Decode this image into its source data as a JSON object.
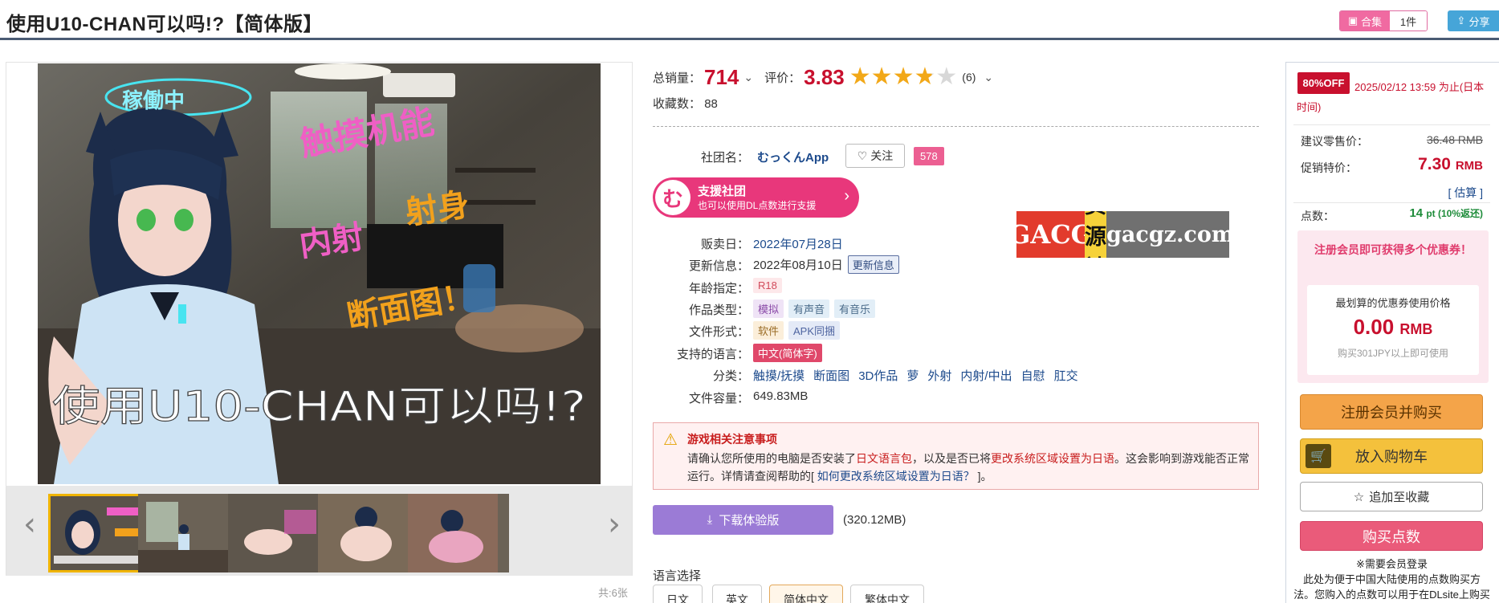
{
  "title": "使用U10-CHAN可以吗!?【简体版】",
  "collection": {
    "label": "合集",
    "count": "1件"
  },
  "share_label": "分享",
  "gallery": {
    "overlay_texts": [
      "稼働中",
      "触摸机能",
      "内射",
      "射身",
      "断面图！",
      "使用U10-CHAN可以吗!?"
    ],
    "count_label": "共:6张",
    "prev_icon": "‹",
    "next_icon": "›"
  },
  "stats": {
    "sales_label": "总销量：",
    "sales_value": "714",
    "rating_label": "评价：",
    "rating_value": "3.83",
    "rating_count": "(6)",
    "rating_stars": 3.83,
    "fav_label": "收藏数：",
    "fav_value": "88"
  },
  "circle": {
    "label": "社团名：",
    "name": "むっくんApp",
    "follow_label": "关注",
    "follow_count": "578"
  },
  "support_banner": {
    "icon": "む",
    "title": "支援社团",
    "subtitle": "也可以使用DL点数进行支援"
  },
  "ad_logo": {
    "part1": "GACG",
    "part2": "资源社",
    "part3": "gacgz.com"
  },
  "meta": {
    "release_label": "贩卖日：",
    "release_value": "2022年07月28日",
    "update_label": "更新信息：",
    "update_value": "2022年08月10日",
    "update_btn": "更新信息",
    "age_label": "年龄指定：",
    "age_value": "R18",
    "type_label": "作品类型：",
    "type_tags": [
      "模拟",
      "有声音",
      "有音乐"
    ],
    "format_label": "文件形式：",
    "format_tags": [
      "软件",
      "APK同捆"
    ],
    "lang_label": "支持的语言：",
    "lang_value": "中文(简体字)",
    "genre_label": "分类：",
    "genres": [
      "触摸/抚摸",
      "断面图",
      "3D作品",
      "萝",
      "外射",
      "内射/中出",
      "自慰",
      "肛交"
    ],
    "size_label": "文件容量：",
    "size_value": "649.83MB"
  },
  "notice": {
    "title": "游戏相关注意事项",
    "t1": "请确认您所使用的电脑是否安装了",
    "r1": "日文语言包",
    "t2": "，以及是否已将",
    "r2": "更改系统区域设置为日语",
    "t3": "。这会影响到游戏能否正常运行。详情请查阅帮助的[ ",
    "link": "如何更改系统区域设置为日语？",
    "t4": " ]。"
  },
  "download": {
    "label": "下载体验版",
    "size": "(320.12MB)"
  },
  "language_select": {
    "label": "语言选择",
    "options": [
      "日文",
      "英文",
      "简体中文",
      "繁体中文"
    ]
  },
  "sidebar": {
    "off_badge": "80%OFF",
    "sale_until": "2025/02/12 13:59 为止(日本时间)",
    "retail_label": "建议零售价：",
    "retail_value": "36.48 RMB",
    "sale_label": "促销特价：",
    "sale_value": "7.30",
    "sale_unit": "RMB",
    "estimate": "[ 估算 ]",
    "points_label": "点数：",
    "points_value": "14",
    "points_unit": "pt (10%返还)",
    "coupon_title": "注册会员即可获得多个优惠券！",
    "coupon_line1": "最划算的优惠券使用价格",
    "coupon_price": "0.00",
    "coupon_unit": "RMB",
    "coupon_note": "购买301JPY以上即可使用",
    "register_btn": "注册会员并购买",
    "cart_btn": "放入购物车",
    "fav_btn": "追加至收藏",
    "buy_points_btn": "购买点数",
    "note": "※需要会员登录\n此处为便于中国大陆使用的点数购买方法。您购入的点数可以用于在DLsite上购买作品。"
  },
  "colors": {
    "accent_red": "#c8102e",
    "pink": "#e8377b",
    "link_blue": "#1c4a8c"
  }
}
